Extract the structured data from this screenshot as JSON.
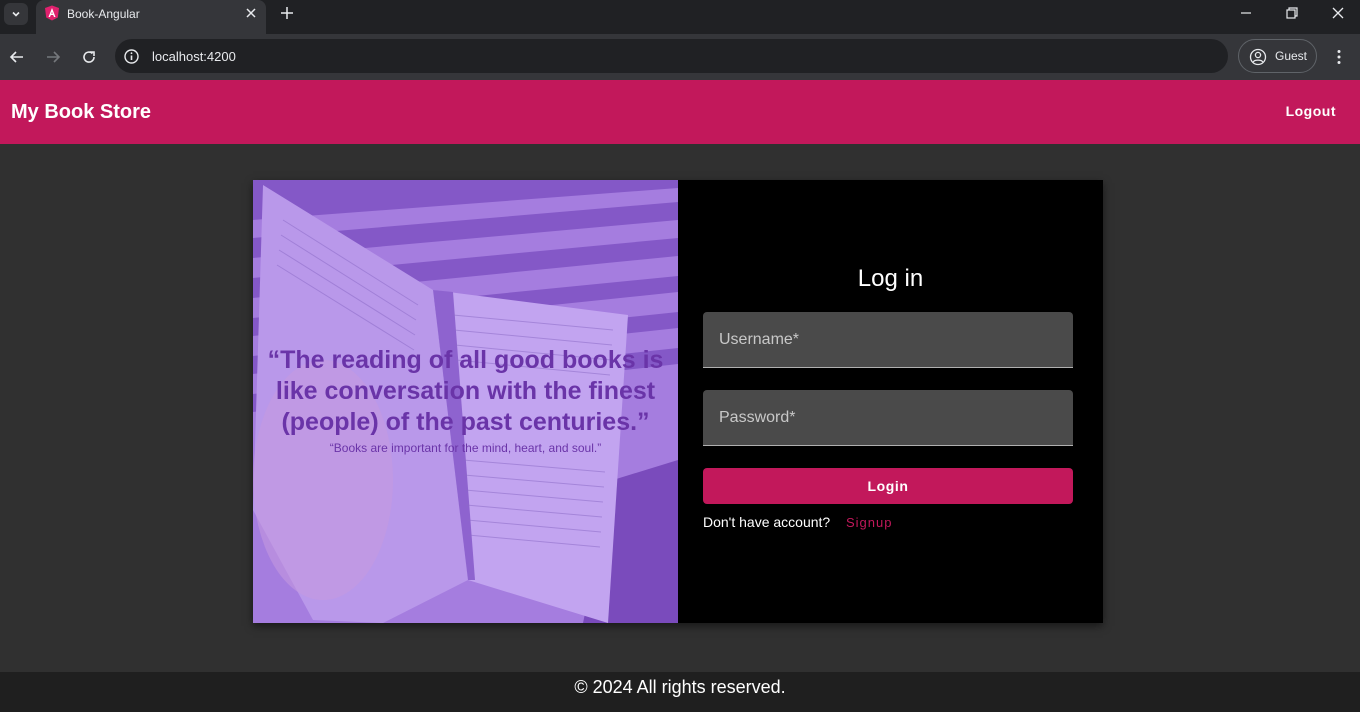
{
  "browser": {
    "tab_title": "Book-Angular",
    "url": "localhost:4200",
    "profile_label": "Guest"
  },
  "app": {
    "brand": "My Book Store",
    "logout_label": "Logout"
  },
  "hero": {
    "quote": "“The reading of all good books is like conversation with the finest (people) of the past centuries.”",
    "subquote": "“Books are important for the mind, heart, and soul.”"
  },
  "login": {
    "title": "Log in",
    "username_label": "Username*",
    "password_label": "Password*",
    "submit_label": "Login",
    "no_account_text": "Don't have account?",
    "signup_label": "Signup"
  },
  "footer": {
    "text": "© 2024 All rights reserved."
  },
  "colors": {
    "primary": "#c2185b",
    "hero_tint": "#9c6fd8",
    "quote_text": "#6a34a8"
  },
  "icons": [
    "tab-search-icon",
    "angular-favicon-icon",
    "close-icon",
    "plus-icon",
    "minimize-icon",
    "restore-icon",
    "back-icon",
    "forward-icon",
    "reload-icon",
    "info-icon",
    "profile-icon",
    "kebab-menu-icon"
  ]
}
